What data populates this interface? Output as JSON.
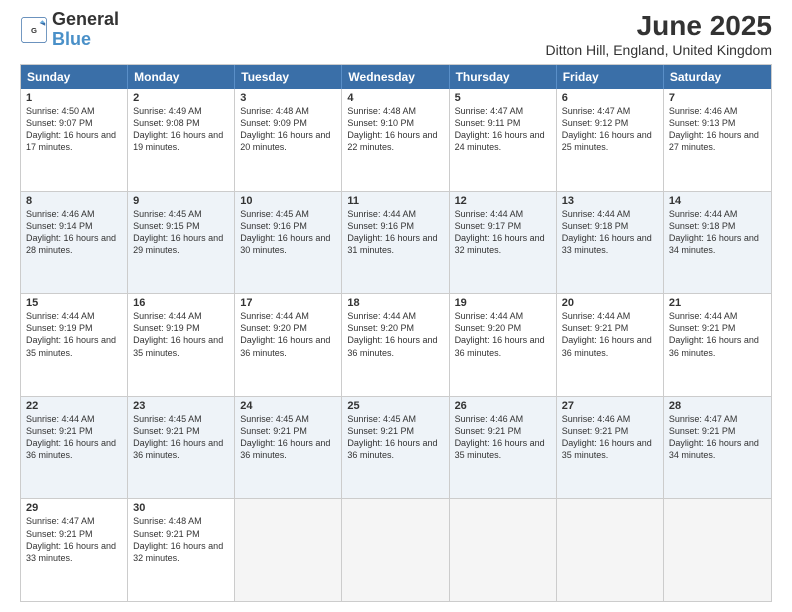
{
  "logo": {
    "general": "General",
    "blue": "Blue"
  },
  "title": "June 2025",
  "subtitle": "Ditton Hill, England, United Kingdom",
  "days": [
    "Sunday",
    "Monday",
    "Tuesday",
    "Wednesday",
    "Thursday",
    "Friday",
    "Saturday"
  ],
  "weeks": [
    [
      {
        "day": "1",
        "sunrise": "4:50 AM",
        "sunset": "9:07 PM",
        "daylight": "16 hours and 17 minutes."
      },
      {
        "day": "2",
        "sunrise": "4:49 AM",
        "sunset": "9:08 PM",
        "daylight": "16 hours and 19 minutes."
      },
      {
        "day": "3",
        "sunrise": "4:48 AM",
        "sunset": "9:09 PM",
        "daylight": "16 hours and 20 minutes."
      },
      {
        "day": "4",
        "sunrise": "4:48 AM",
        "sunset": "9:10 PM",
        "daylight": "16 hours and 22 minutes."
      },
      {
        "day": "5",
        "sunrise": "4:47 AM",
        "sunset": "9:11 PM",
        "daylight": "16 hours and 24 minutes."
      },
      {
        "day": "6",
        "sunrise": "4:47 AM",
        "sunset": "9:12 PM",
        "daylight": "16 hours and 25 minutes."
      },
      {
        "day": "7",
        "sunrise": "4:46 AM",
        "sunset": "9:13 PM",
        "daylight": "16 hours and 27 minutes."
      }
    ],
    [
      {
        "day": "8",
        "sunrise": "4:46 AM",
        "sunset": "9:14 PM",
        "daylight": "16 hours and 28 minutes."
      },
      {
        "day": "9",
        "sunrise": "4:45 AM",
        "sunset": "9:15 PM",
        "daylight": "16 hours and 29 minutes."
      },
      {
        "day": "10",
        "sunrise": "4:45 AM",
        "sunset": "9:16 PM",
        "daylight": "16 hours and 30 minutes."
      },
      {
        "day": "11",
        "sunrise": "4:44 AM",
        "sunset": "9:16 PM",
        "daylight": "16 hours and 31 minutes."
      },
      {
        "day": "12",
        "sunrise": "4:44 AM",
        "sunset": "9:17 PM",
        "daylight": "16 hours and 32 minutes."
      },
      {
        "day": "13",
        "sunrise": "4:44 AM",
        "sunset": "9:18 PM",
        "daylight": "16 hours and 33 minutes."
      },
      {
        "day": "14",
        "sunrise": "4:44 AM",
        "sunset": "9:18 PM",
        "daylight": "16 hours and 34 minutes."
      }
    ],
    [
      {
        "day": "15",
        "sunrise": "4:44 AM",
        "sunset": "9:19 PM",
        "daylight": "16 hours and 35 minutes."
      },
      {
        "day": "16",
        "sunrise": "4:44 AM",
        "sunset": "9:19 PM",
        "daylight": "16 hours and 35 minutes."
      },
      {
        "day": "17",
        "sunrise": "4:44 AM",
        "sunset": "9:20 PM",
        "daylight": "16 hours and 36 minutes."
      },
      {
        "day": "18",
        "sunrise": "4:44 AM",
        "sunset": "9:20 PM",
        "daylight": "16 hours and 36 minutes."
      },
      {
        "day": "19",
        "sunrise": "4:44 AM",
        "sunset": "9:20 PM",
        "daylight": "16 hours and 36 minutes."
      },
      {
        "day": "20",
        "sunrise": "4:44 AM",
        "sunset": "9:21 PM",
        "daylight": "16 hours and 36 minutes."
      },
      {
        "day": "21",
        "sunrise": "4:44 AM",
        "sunset": "9:21 PM",
        "daylight": "16 hours and 36 minutes."
      }
    ],
    [
      {
        "day": "22",
        "sunrise": "4:44 AM",
        "sunset": "9:21 PM",
        "daylight": "16 hours and 36 minutes."
      },
      {
        "day": "23",
        "sunrise": "4:45 AM",
        "sunset": "9:21 PM",
        "daylight": "16 hours and 36 minutes."
      },
      {
        "day": "24",
        "sunrise": "4:45 AM",
        "sunset": "9:21 PM",
        "daylight": "16 hours and 36 minutes."
      },
      {
        "day": "25",
        "sunrise": "4:45 AM",
        "sunset": "9:21 PM",
        "daylight": "16 hours and 36 minutes."
      },
      {
        "day": "26",
        "sunrise": "4:46 AM",
        "sunset": "9:21 PM",
        "daylight": "16 hours and 35 minutes."
      },
      {
        "day": "27",
        "sunrise": "4:46 AM",
        "sunset": "9:21 PM",
        "daylight": "16 hours and 35 minutes."
      },
      {
        "day": "28",
        "sunrise": "4:47 AM",
        "sunset": "9:21 PM",
        "daylight": "16 hours and 34 minutes."
      }
    ],
    [
      {
        "day": "29",
        "sunrise": "4:47 AM",
        "sunset": "9:21 PM",
        "daylight": "16 hours and 33 minutes."
      },
      {
        "day": "30",
        "sunrise": "4:48 AM",
        "sunset": "9:21 PM",
        "daylight": "16 hours and 32 minutes."
      },
      null,
      null,
      null,
      null,
      null
    ]
  ],
  "row_alt": [
    false,
    true,
    false,
    true,
    false
  ]
}
